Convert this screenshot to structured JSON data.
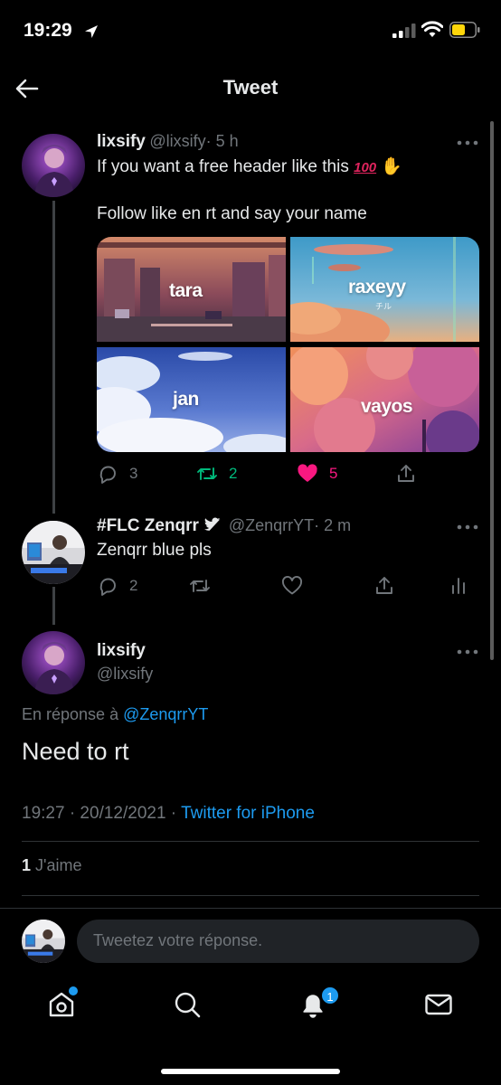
{
  "status": {
    "time": "19:29"
  },
  "nav": {
    "title": "Tweet"
  },
  "tweet1": {
    "name": "lixsify",
    "handle": "@lixsify",
    "time": "· 5 h",
    "text": "If you want a free header like this",
    "emoji_100": "100",
    "emoji_hand": "✋",
    "text2": "Follow like en rt and say your name",
    "media": [
      {
        "label": "tara"
      },
      {
        "label": "raxeyy",
        "sub": "チル"
      },
      {
        "label": "jan"
      },
      {
        "label": "vayos"
      }
    ],
    "replies": "3",
    "retweets": "2",
    "likes": "5",
    "colors": {
      "retweet": "#00ba7c",
      "like": "#f91880"
    }
  },
  "tweet2": {
    "name": "#FLC Zenqrr",
    "handle": "@ZenqrrYT",
    "time": "· 2 m",
    "text": "Zenqrr blue pls",
    "replies": "2"
  },
  "tweet3": {
    "name": "lixsify",
    "handle": "@lixsify",
    "reply_prefix": "En réponse à ",
    "reply_to": "@ZenqrrYT",
    "text": "Need to rt",
    "timestamp": "19:27 · 20/12/2021 · ",
    "source": "Twitter for iPhone",
    "like_count": "1",
    "like_label": " J'aime"
  },
  "reply": {
    "placeholder": "Tweetez votre réponse."
  },
  "tabs": {
    "notif_count": "1"
  },
  "accent": "#1d9bf0"
}
